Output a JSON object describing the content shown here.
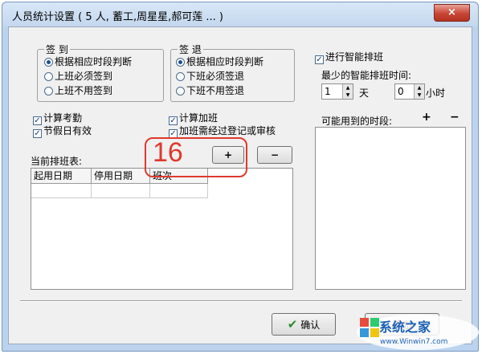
{
  "window": {
    "title": "人员统计设置 ( 5 人, 蓄工,周星星,郝可莲 ... )",
    "close_glyph": "×"
  },
  "signin": {
    "title": "签 到",
    "options": [
      "根据相应时段判断",
      "上班必须签到",
      "上班不用签到"
    ],
    "selected": 0
  },
  "signout": {
    "title": "签 退",
    "options": [
      "根据相应时段判断",
      "下班必须签退",
      "下班不用签退"
    ],
    "selected": 0
  },
  "checks": {
    "calc_attendance": "计算考勤",
    "holiday_valid": "节假日有效",
    "calc_overtime": "计算加班",
    "overtime_approval": "加班需经过登记或审核",
    "check_glyph": "✓"
  },
  "schedule": {
    "label": "当前排班表:",
    "add_button": "+",
    "remove_button": "−",
    "columns": [
      "起用日期",
      "停用日期",
      "班次"
    ]
  },
  "smart": {
    "enable_label": "进行智能排班",
    "min_time_label": "最少的智能排班时间:",
    "days_value": "1",
    "days_unit": "天",
    "hours_value": "0",
    "hours_unit": "小时",
    "periods_label": "可能用到的时段:",
    "add_glyph": "+",
    "remove_glyph": "−"
  },
  "footer": {
    "ok_label": "确认",
    "cancel_label": "放"
  },
  "annotation": {
    "step_number": "16",
    "color": "#e0392c"
  },
  "watermark": {
    "brand": "系统之家",
    "url": "www.Winwin7.com"
  },
  "colors": {
    "title_bg": "#c3d7ee",
    "client_bg": "#f0f0f0",
    "close_red": "#c84535"
  }
}
